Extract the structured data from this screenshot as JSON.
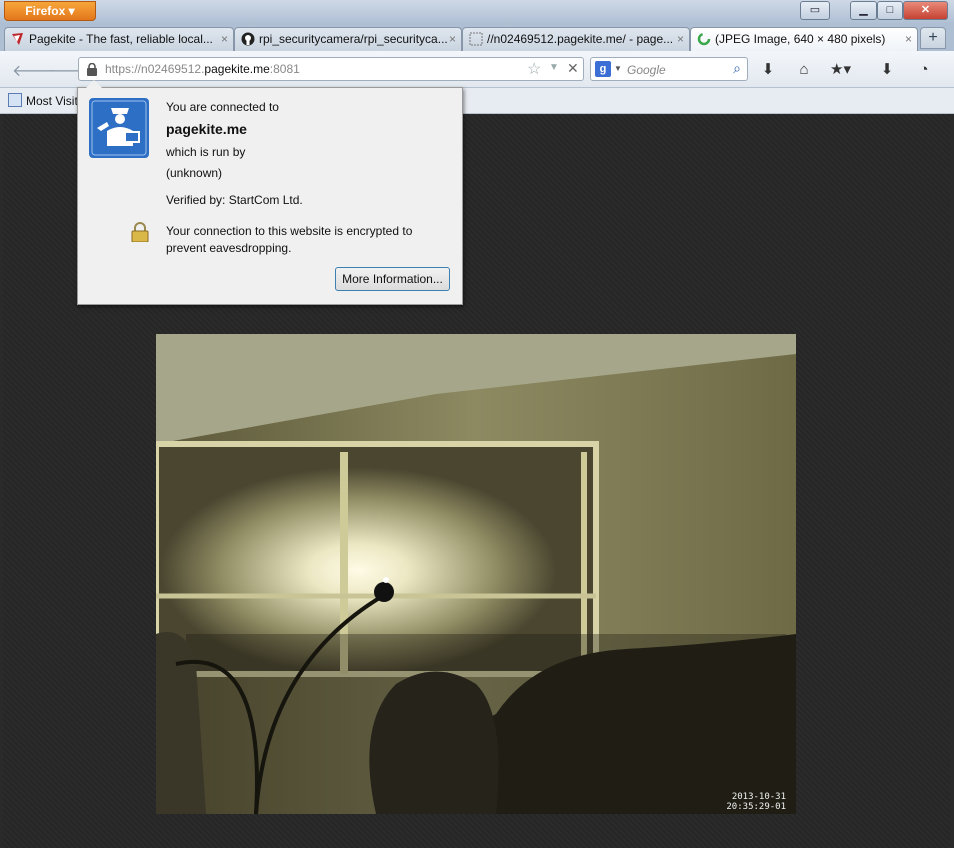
{
  "browser": {
    "menu_label": "Firefox"
  },
  "tabs": [
    {
      "title": "Pagekite - The fast, reliable local..."
    },
    {
      "title": "rpi_securitycamera/rpi_securityca..."
    },
    {
      "title": "//n02469512.pagekite.me/ - page..."
    },
    {
      "title": "(JPEG Image, 640 × 480 pixels)"
    }
  ],
  "navigation": {
    "url_prefix": "https://n02469512.",
    "url_host": "pagekite.me",
    "url_suffix": ":8081",
    "search_placeholder": "Google"
  },
  "bookmarks": {
    "most_visited": "Most Visit"
  },
  "identity_popup": {
    "connected_to": "You are connected to",
    "host": "pagekite.me",
    "run_by": "which is run by",
    "owner": "(unknown)",
    "verified_by": "Verified by: StartCom Ltd.",
    "encryption_line1": "Your connection to this website is encrypted to",
    "encryption_line2": "prevent eavesdropping.",
    "more_info_button": "More Information..."
  },
  "camera": {
    "date": "2013-10-31",
    "time": "20:35:29-01"
  },
  "colors": {
    "firefox_orange": "#e3761b",
    "accent_blue": "#2d6fc4",
    "page_bg": "#2a2a2a"
  },
  "icons": [
    "pagekite-favicon",
    "github-favicon",
    "blank-favicon",
    "loading-spinner-icon",
    "back-icon",
    "forward-icon",
    "lock-icon",
    "star-icon",
    "dropdown-icon",
    "stop-icon",
    "google-icon",
    "search-icon",
    "download-icon",
    "home-icon",
    "bookmarks-icon",
    "save-icon",
    "account-icon",
    "bookmark-folder-icon",
    "identity-officer-icon",
    "padlock-icon",
    "close-icon",
    "minimize-icon",
    "maximize-icon",
    "restore-icon",
    "new-tab-icon"
  ]
}
